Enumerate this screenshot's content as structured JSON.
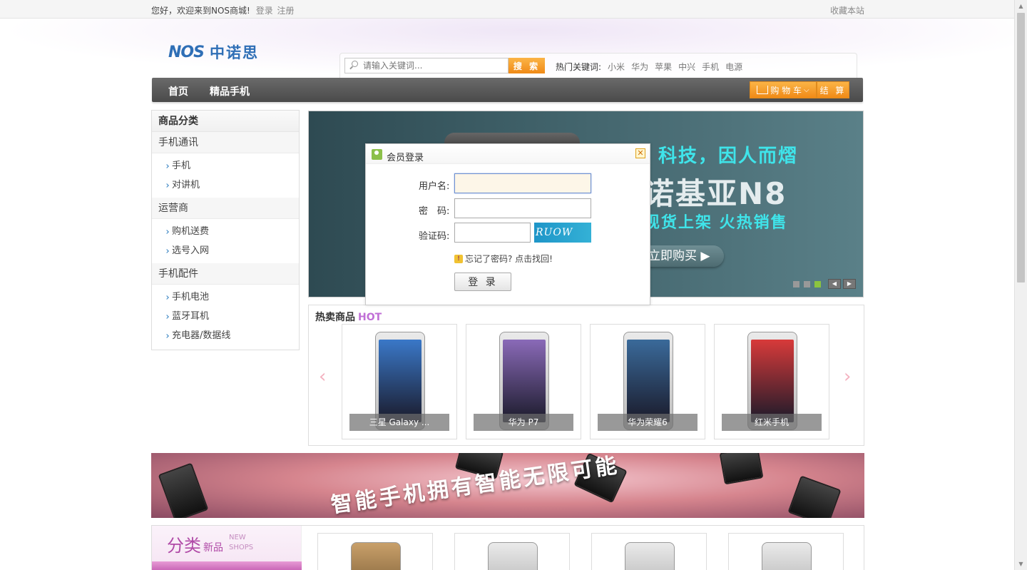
{
  "topbar": {
    "welcome": "您好，欢迎来到NOS商城!",
    "login": "登录",
    "register": "注册",
    "favorite": "收藏本站"
  },
  "header": {
    "logo_mark": "NOS",
    "logo_cn": "中诺思",
    "search_placeholder": "请输入关键词...",
    "search_button": "搜 索",
    "hotwords_label": "热门关键词:",
    "hotwords": [
      "小米",
      "华为",
      "苹果",
      "中兴",
      "手机",
      "电源"
    ]
  },
  "nav": {
    "items": [
      "首页",
      "精品手机"
    ],
    "cart": "购 物 车",
    "checkout": "结 算"
  },
  "sidebar": {
    "title": "商品分类",
    "groups": [
      {
        "name": "手机通讯",
        "items": [
          "手机",
          "对讲机"
        ]
      },
      {
        "name": "运营商",
        "items": [
          "购机送费",
          "选号入网"
        ]
      },
      {
        "name": "手机配件",
        "items": [
          "手机电池",
          "蓝牙耳机",
          "充电器/数据线"
        ]
      }
    ]
  },
  "banner": {
    "line1": "科技，因人而熠",
    "line2": "诺基亚N8",
    "line3": "现货上架  火热销售",
    "buy": "立即购买 ▶"
  },
  "hot": {
    "title": "热卖商品",
    "tag": "HOT",
    "products": [
      {
        "name": "三星 Galaxy ...",
        "screen": "#3a78c8"
      },
      {
        "name": "华为 P7",
        "screen": "#8a6ab8"
      },
      {
        "name": "华为荣耀6",
        "screen": "#3a6a9a"
      },
      {
        "name": "红米手机",
        "screen": "#d83a3a"
      }
    ]
  },
  "slogan": {
    "text": "智能手机拥有智能无限可能"
  },
  "newcat": {
    "big": "分类",
    "small": "新品",
    "en_line1": "NEW",
    "en_line2": "SHOPS"
  },
  "modal": {
    "title": "会员登录",
    "close": "✕",
    "username_label": "用户名:",
    "password_label": "密　码:",
    "captcha_label": "验证码:",
    "captcha_text": "RUOW",
    "forgot": "忘记了密码? 点击找回!",
    "login_button": "登 录"
  },
  "colors": {
    "accent_orange": "#f08a17",
    "nav_dark": "#555555",
    "brand_blue": "#2f6fb6",
    "hot_purple": "#c06fd6"
  }
}
